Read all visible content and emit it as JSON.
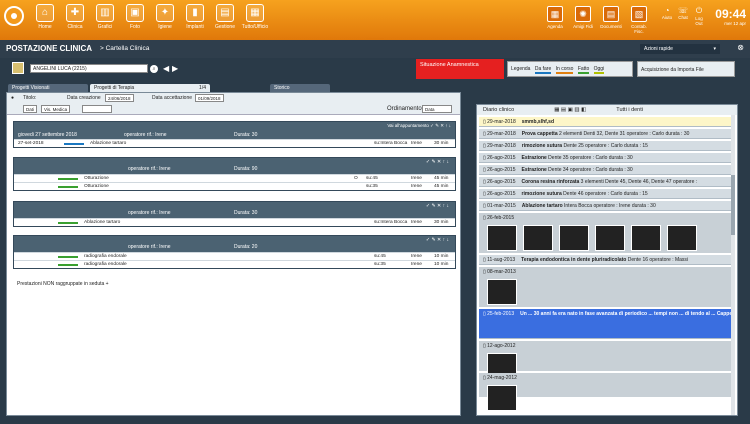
{
  "topbar": {
    "items": [
      "Home",
      "Clinica",
      "Grafici",
      "Foto",
      "Igiene",
      "Implanti",
      "Gestione",
      "Tutto/Ufficio"
    ],
    "right_items": [
      "Agenda",
      "Amigi Fidi",
      "Documenti",
      "Contab. Fisc."
    ],
    "small": [
      "Aiuto",
      "Chat",
      "Log Out"
    ],
    "time": "09:44",
    "date": "mer 12 apr"
  },
  "header": {
    "title": "POSTAZIONE CLINICA",
    "sub": "> Cartella Clinica",
    "azioni": "Azioni rapide"
  },
  "patient": {
    "name": "ANGELINI LUCA   (2215)"
  },
  "alert": {
    "text": "Situazione Anamnestica"
  },
  "legend": {
    "label": "Legenda",
    "da": "Da fare",
    "in": "In corso",
    "fatto": "Fatto",
    "oggi": "Oggi"
  },
  "acq": {
    "label": "Acquisizione da Importa File"
  },
  "tabs": {
    "a": "Progetti Visionati",
    "b": "Progetti di Terapia",
    "pager": "1/4",
    "c": "Storico"
  },
  "left": {
    "titolo": "Titolo:",
    "data_creazione_label": "Data creazione",
    "data_creazione": "24/06/2018",
    "data_acc_label": "Data accettazione",
    "data_acc": "01/09/2018",
    "dati": "Dati",
    "vis": "Vis. Medica",
    "ordinamento": "Ordinamento",
    "ordinamento_val": "Data",
    "sedute": [
      {
        "header": "giovedi 27 settembre 2018",
        "op": "operatore rif.: Irene",
        "dur": "Durata: 30",
        "link": "Vai all'appuntamento",
        "rows": [
          {
            "d": "27-set-2018",
            "t": "Ablazione tartaro",
            "s": "su:Intera Bocca",
            "o": "Irene",
            "m": "30 min",
            "c": "b"
          }
        ]
      },
      {
        "header": "",
        "op": "operatore rif.: Irene",
        "dur": "Durata: 90",
        "rows": [
          {
            "d": "",
            "t": "Otturazione",
            "s": "su:45",
            "x": "O",
            "o": "Irene",
            "m": "45 min",
            "c": "g"
          },
          {
            "d": "",
            "t": "Otturazione",
            "s": "su:35",
            "x": "",
            "o": "Irene",
            "m": "45 min",
            "c": "g"
          }
        ]
      },
      {
        "header": "",
        "op": "operatore rif.: Irene",
        "dur": "Durata: 30",
        "rows": [
          {
            "d": "",
            "t": "Ablazione tartaro",
            "s": "su:Intera Bocca",
            "o": "Irene",
            "m": "30 min",
            "c": "g"
          }
        ]
      },
      {
        "header": "",
        "op": "operatore rif.: Irene",
        "dur": "Durata: 20",
        "rows": [
          {
            "d": "",
            "t": "radiografia endorale",
            "s": "su:45",
            "o": "Irene",
            "m": "10 min",
            "c": "g"
          },
          {
            "d": "",
            "t": "radiografia endorale",
            "s": "su:35",
            "o": "Irene",
            "m": "10 min",
            "c": "g"
          }
        ]
      }
    ],
    "prest": "Prestazioni NON raggruppate in seduta"
  },
  "right": {
    "title": "Diario clinico",
    "filter": "Tutti i denti",
    "rows": [
      {
        "d": "29-mar-2018",
        "t": "smmb,slhf,sd",
        "y": true
      },
      {
        "d": "29-mar-2018",
        "t": "Prova cappetta",
        "r": "2 elementi  Denti 32, Dente 31  operatore : Carlo  durata : 30"
      },
      {
        "d": "29-mar-2018",
        "t": "rimozione sutura",
        "r": "Dente 25  operatore : Carlo  durata : 15"
      },
      {
        "d": "26-ago-2015",
        "t": "Estrazione",
        "r": "Dente 35  operatore : Carlo  durata : 30"
      },
      {
        "d": "26-ago-2015",
        "t": "Estrazione",
        "r": "Dente 34  operatore : Carlo  durata : 30"
      },
      {
        "d": "26-ago-2015",
        "t": "Corona resina rinforzata",
        "r": "3 elementi  Dente 45, Dente 46, Dente 47  operatore :"
      },
      {
        "d": "26-ago-2015",
        "t": "rimozione sutura",
        "r": "Dente 46  operatore : Carlo  durata : 15"
      },
      {
        "d": "01-mar-2015",
        "t": "Ablazione tartaro",
        "r": "Intera Bocca  operatore : Irene  durata : 30"
      }
    ],
    "g1": "26-feb-2015",
    "row_aug": {
      "d": "11-aug-2013",
      "t": "Terapia endodontica in dente pluriradicolato",
      "r": "Dente 16  operatore : Massi"
    },
    "g2": "08-mar-2013",
    "sel": {
      "d": "25-feb-2013",
      "t": "Un ... 30 anni fa era nato in fase avanzata di periodico ... tempi non ... di tendo al ... Cappella protesica e ... medicazione ... pietra ... domiciliare; Sikkyfluo"
    },
    "g3": "12-ago-2012",
    "g4": "24-mag-2012"
  }
}
